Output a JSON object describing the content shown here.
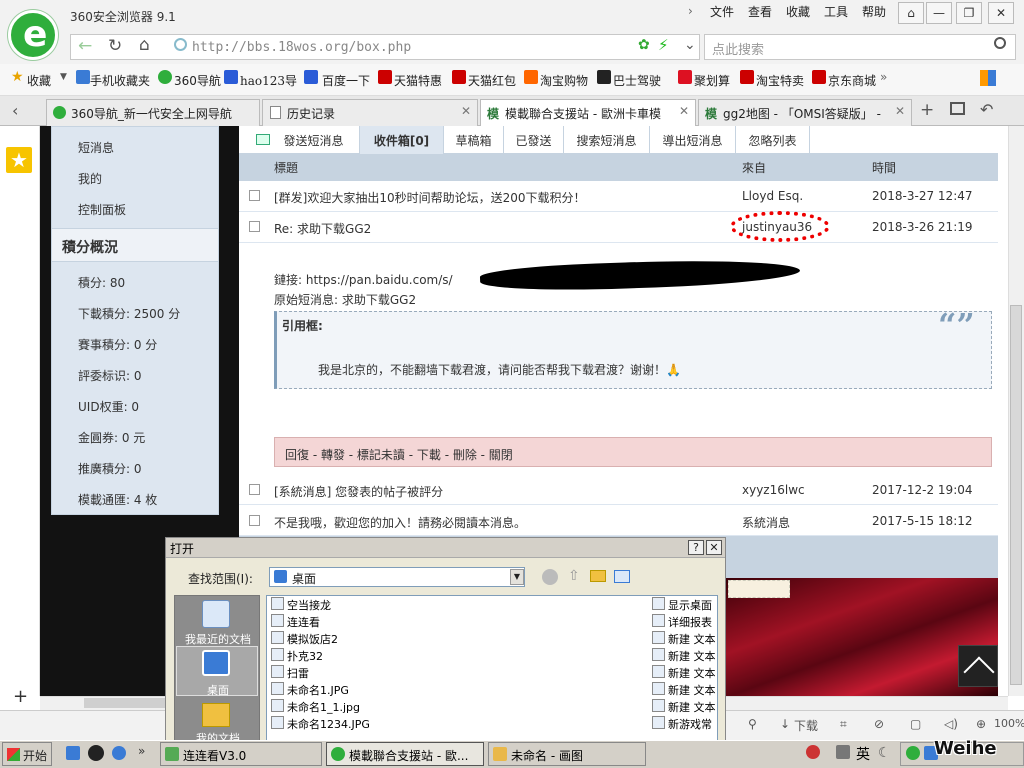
{
  "browser": {
    "app_title": "360安全浏览器 9.1",
    "menu": [
      "文件",
      "查看",
      "收藏",
      "工具",
      "帮助"
    ],
    "window_buttons": [
      "⌂",
      "—",
      "❐",
      "✕"
    ],
    "address": "http://bbs.18wos.org/box.php",
    "search_placeholder": "点此搜索",
    "favorites": [
      "收藏",
      "手机收藏夹",
      "360导航",
      "hao123导",
      "百度一下",
      "天猫特惠",
      "天猫红包",
      "淘宝购物",
      "巴士驾驶",
      "聚划算",
      "淘宝特卖",
      "京东商城"
    ],
    "tabs": [
      {
        "label": "360导航_新一代安全上网导航",
        "active": false
      },
      {
        "label": "历史记录",
        "active": false
      },
      {
        "label": "模載聯合支援站 - 歐洲卡車模",
        "active": true
      },
      {
        "label": "gg2地图 - 「OMSI答疑版」 - ",
        "active": false
      }
    ],
    "status_right": [
      "下载",
      "100%"
    ]
  },
  "forum": {
    "side_links": [
      "短消息",
      "我的",
      "控制面板"
    ],
    "points_title": "積分概況",
    "points": [
      "積分: 80",
      "下載積分: 2500 分",
      "賽事積分: 0 分",
      "評委标识: 0",
      "UID权重: 0",
      "金圓券: 0 元",
      "推廣積分: 0",
      "模載通匯: 4 枚"
    ],
    "pm_tabs": [
      "發送短消息",
      "收件箱[0]",
      "草稿箱",
      "已發送",
      "搜索短消息",
      "導出短消息",
      "忽略列表"
    ],
    "columns": {
      "title": "標題",
      "from": "來自",
      "time": "時間"
    },
    "messages": [
      {
        "title": "[群发]欢迎大家抽出10秒时间帮助论坛，送200下载积分！",
        "from": "Lloyd Esq.",
        "time": "2018-3-27 12:47"
      },
      {
        "title": "Re: 求助下载GG2",
        "from": "justinyau36",
        "time": "2018-3-26 21:19"
      },
      {
        "title": "[系統消息] 您發表的帖子被評分",
        "from": "xyyz16lwc",
        "time": "2017-12-2 19:04"
      },
      {
        "title": "不是我哦，歡迎您的加入！請務必閱讀本消息。",
        "from": "系統消息",
        "time": "2017-5-15 18:12"
      }
    ],
    "expanded": {
      "link": "鏈接: https://pan.baidu.com/s/",
      "original": "原始短消息: 求助下载GG2",
      "quote_label": "引用框:",
      "quote_text": "我是北京的，不能翻墙下载君渡，请问能否帮我下载君渡？谢谢！🙏",
      "actions": "回復 - 轉發 - 標記未讀 - 下載 - 刪除 - 關閉"
    }
  },
  "dialog": {
    "title": "打开",
    "look_in_label": "查找范围(I):",
    "look_in_value": "桌面",
    "places": [
      "我最近的文档",
      "桌面",
      "我的文档"
    ],
    "files_left": [
      "空当接龙",
      "连连看",
      "模拟饭店2",
      "扑克32",
      "扫雷",
      "未命名1.JPG",
      "未命名1_1.jpg",
      "未命名1234.JPG"
    ],
    "files_right": [
      "显示桌面",
      "详细报表",
      "新建 文本",
      "新建 文本",
      "新建 文本",
      "新建 文本",
      "新建 文本",
      "新游戏常"
    ]
  },
  "taskbar": {
    "start": "开始",
    "tasks": [
      {
        "label": "连连看V3.0",
        "active": false
      },
      {
        "label": "模載聯合支援站 - 歐...",
        "active": true
      },
      {
        "label": "未命名 - 画图",
        "active": false
      }
    ],
    "ime": "英",
    "watermark": "Weihe"
  },
  "colors": {
    "panel_blue": "#dde6f0",
    "header_blue": "#c6d3e0",
    "action_pink": "#f4d6d6",
    "annotation_red": "#e00000"
  }
}
